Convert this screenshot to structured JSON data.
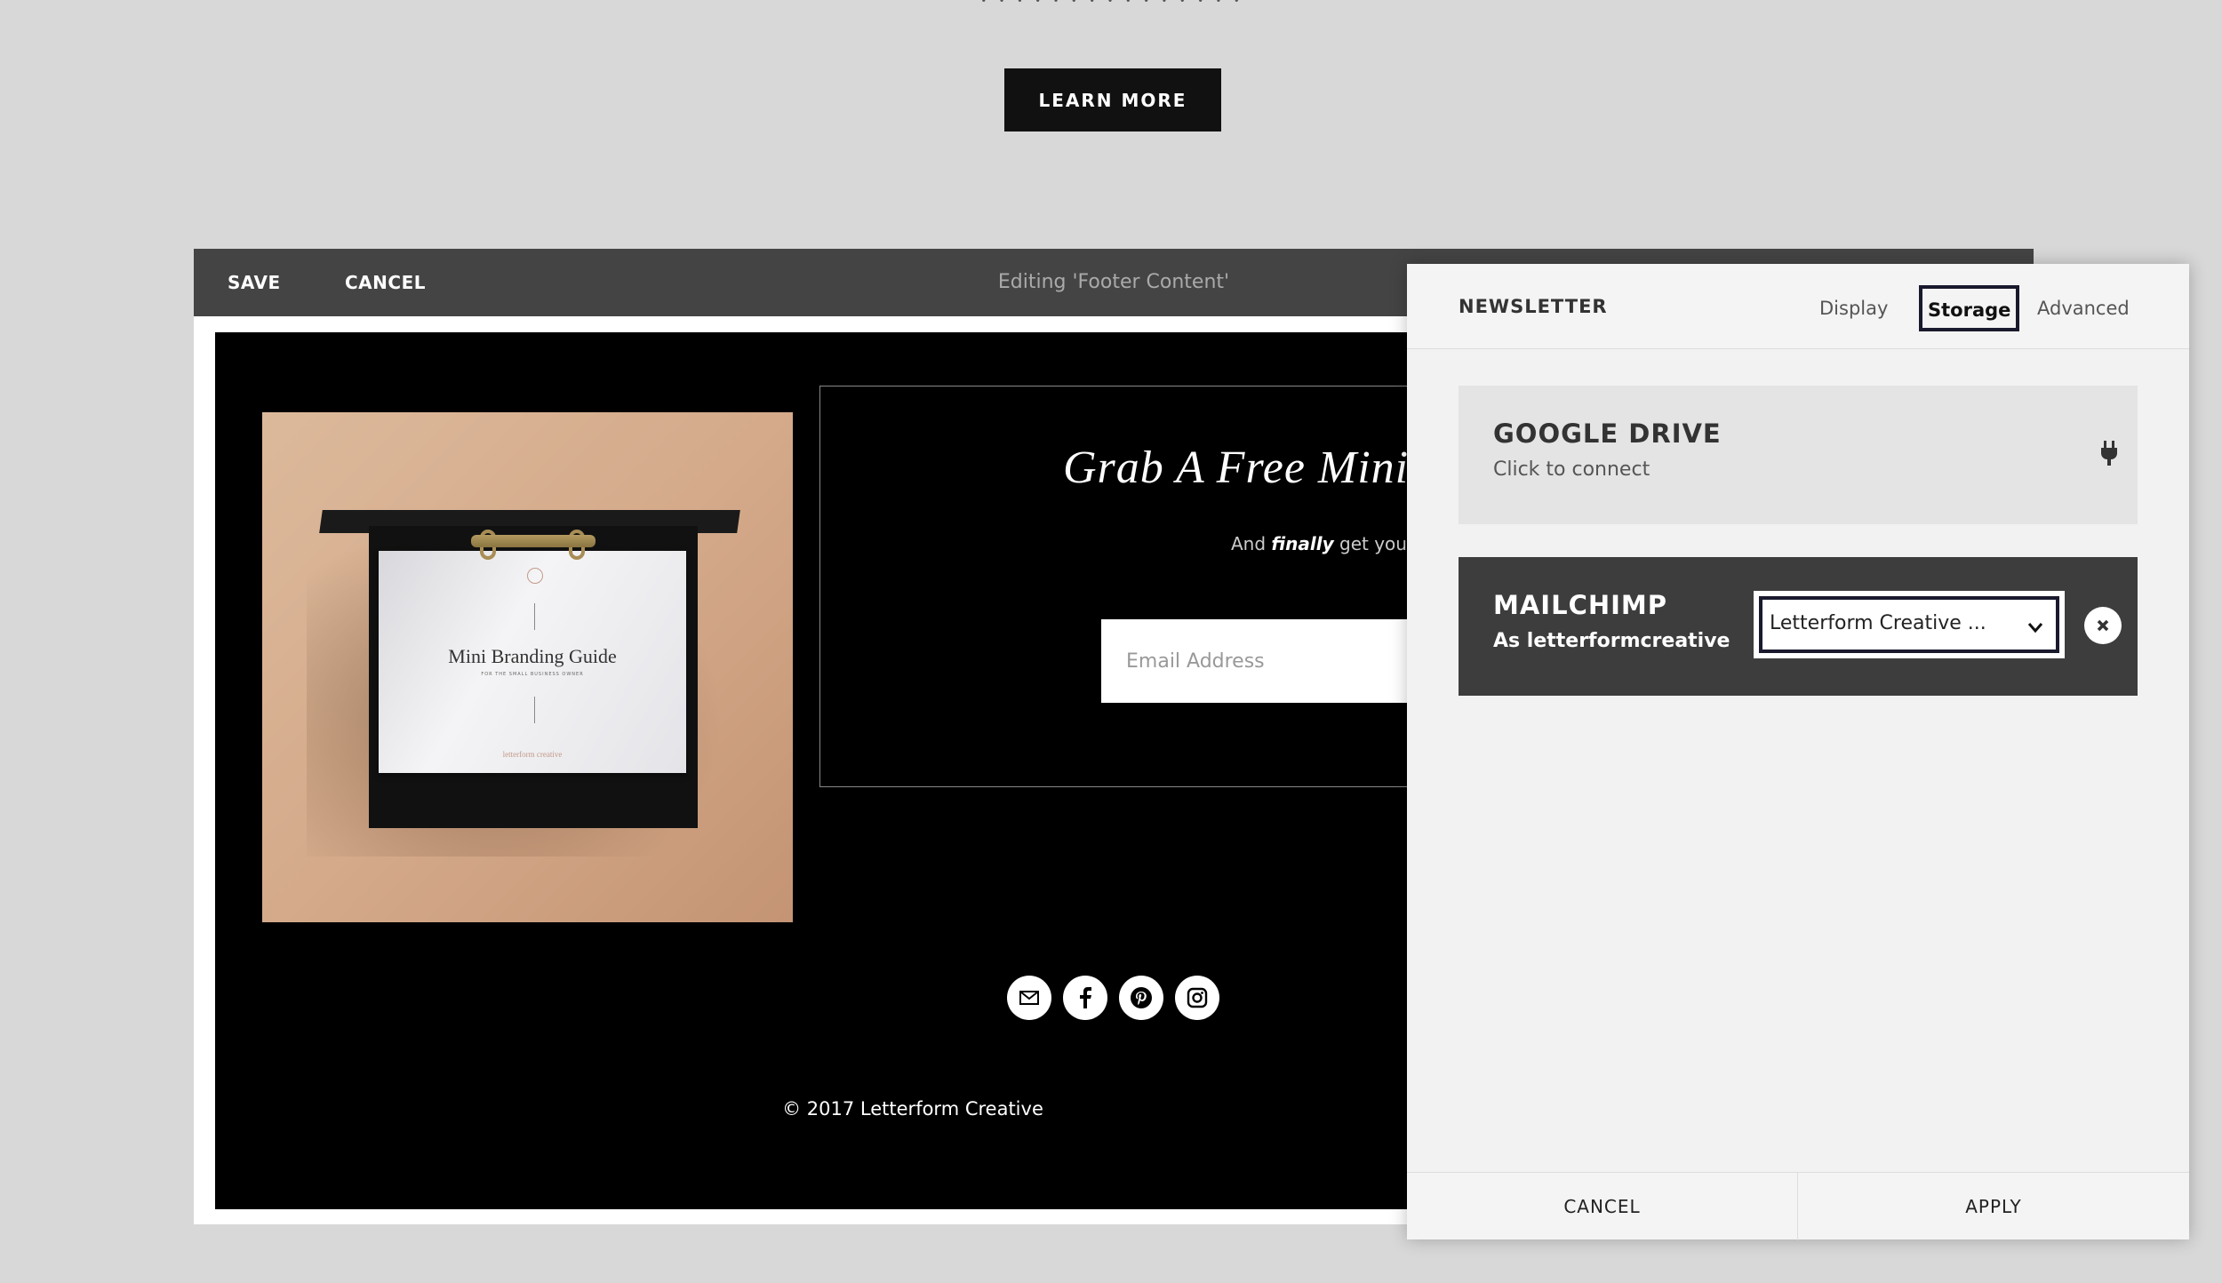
{
  "page": {
    "learn_more": "LEARN MORE"
  },
  "editor_bar": {
    "save": "SAVE",
    "cancel": "CANCEL",
    "title": "Editing 'Footer Content'"
  },
  "footer": {
    "product": {
      "title": "Mini Branding Guide",
      "subtitle": "FOR THE SMALL BUSINESS OWNER",
      "brand": "letterform creative"
    },
    "signup": {
      "title": "Grab A Free Mini",
      "desc_pre": "And ",
      "desc_emph": "finally",
      "desc_post": " get your br",
      "email_placeholder": "Email Address"
    },
    "social_icons": [
      "mail-icon",
      "facebook-icon",
      "pinterest-icon",
      "instagram-icon"
    ],
    "copyright": "© 2017 Letterform Creative"
  },
  "panel": {
    "title": "NEWSLETTER",
    "tabs": [
      {
        "label": "Display",
        "active": false
      },
      {
        "label": "Storage",
        "active": true
      },
      {
        "label": "Advanced",
        "active": false
      }
    ],
    "services": {
      "google": {
        "name": "GOOGLE DRIVE",
        "status": "Click to connect",
        "icon": "plug-icon"
      },
      "mailchimp": {
        "name": "MAILCHIMP",
        "account": "As letterformcreative",
        "selected_list": "Letterform Creative ...",
        "icon": "remove-icon"
      }
    },
    "footer": {
      "cancel": "CANCEL",
      "apply": "APPLY"
    }
  },
  "colors": {
    "page_bg": "#d8d8d8",
    "editor_bar": "#444444",
    "accent_dark": "#1a1a2e",
    "product_tan": "#d4aa8a"
  }
}
